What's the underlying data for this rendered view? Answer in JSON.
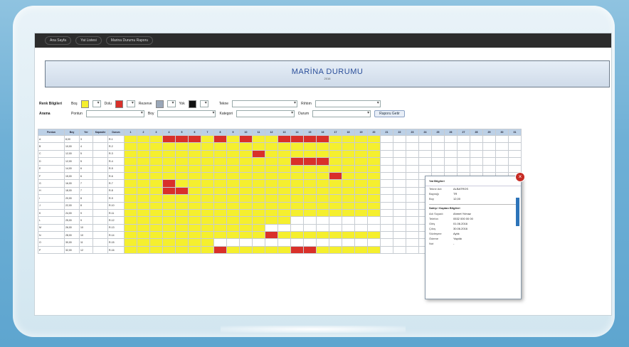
{
  "topbar": {
    "crumbs": [
      "Ana Sayfa",
      "Yat Listesi",
      "Marina Durumu Raporu"
    ]
  },
  "header": {
    "title": "MARİNA DURUMU",
    "subtitle": "2016"
  },
  "filters": {
    "row1_label": "Renk Bilgileri",
    "legend": [
      {
        "label": "Boş",
        "color": "#f5ef2e"
      },
      {
        "label": "Dolu",
        "color": "#d9302a"
      },
      {
        "label": "Rezerve",
        "color": "#9aa7b8"
      },
      {
        "label": "Yok",
        "color": "#111111"
      }
    ],
    "field_a": "Tekne",
    "field_b": "Rıhtım",
    "row2_label": "Arama",
    "field_c": "Pontun",
    "field_d": "Boy",
    "field_e": "Kategori",
    "field_f": "Durum",
    "search_button": "Raporu Getir"
  },
  "grid": {
    "headers": [
      "Pontun",
      "Boy",
      "Yer",
      "Kapasite",
      "Durum",
      "1",
      "2",
      "3",
      "4",
      "5",
      "6",
      "7",
      "8",
      "9",
      "10",
      "11",
      "12",
      "13",
      "14",
      "15",
      "16",
      "17",
      "18",
      "19",
      "20",
      "21",
      "22",
      "23",
      "24",
      "25",
      "26",
      "27",
      "28",
      "29",
      "30",
      "31"
    ],
    "rows": [
      {
        "c": [
          "A",
          "8,00",
          "3",
          "",
          "R-1"
        ],
        "s": "yyyrrryryryyrrrryyyy"
      },
      {
        "c": [
          "B",
          "10,00",
          "4",
          "",
          "R-2"
        ],
        "s": "yyyyyyyyyyyyyyyyyyyy"
      },
      {
        "c": [
          "C",
          "12,00",
          "5",
          "",
          "R-3"
        ],
        "s": "yyyyyyyyyyryyyyyyyyy"
      },
      {
        "c": [
          "D",
          "12,00",
          "5",
          "",
          "R-4"
        ],
        "s": "yyyyyyyyyyyyyrrryyyy"
      },
      {
        "c": [
          "E",
          "14,00",
          "6",
          "",
          "R-5"
        ],
        "s": "yyyyyyyyyyyyyyyyyyyy"
      },
      {
        "c": [
          "F",
          "15,00",
          "6",
          "",
          "R-6"
        ],
        "s": "yyyyyyyyyyyyyyyyryyy"
      },
      {
        "c": [
          "G",
          "16,00",
          "7",
          "",
          "R-7"
        ],
        "s": "yyyryyyyyyyyyyyyyyyy"
      },
      {
        "c": [
          "H",
          "18,00",
          "7",
          "",
          "R-8"
        ],
        "s": "yyyrryyyyyyyyyyyyyyy"
      },
      {
        "c": [
          "I",
          "20,00",
          "8",
          "",
          "R-9"
        ],
        "s": "yyyyyyyyyyyyyyyyyyyy"
      },
      {
        "c": [
          "J",
          "22,00",
          "8",
          "",
          "R-10"
        ],
        "s": "yyyyyyyyyyyyyyyyyyyy"
      },
      {
        "c": [
          "K",
          "24,00",
          "9",
          "",
          "R-11"
        ],
        "s": "yyyyyyyyyyyyyyyyyyyy"
      },
      {
        "c": [
          "L",
          "25,00",
          "9",
          "",
          "R-12"
        ],
        "s": "yyyyyyyyyyyyywwwwwww"
      },
      {
        "c": [
          "M",
          "26,00",
          "10",
          "",
          "R-13"
        ],
        "s": "yyyyyyyyyyywwwwwwwww"
      },
      {
        "c": [
          "N",
          "28,00",
          "10",
          "",
          "R-14"
        ],
        "s": "yyyyyyyyyyyryyyyyyyy"
      },
      {
        "c": [
          "O",
          "30,00",
          "11",
          "",
          "R-15"
        ],
        "s": "yyyyyyywwwwwwwwwwwww"
      },
      {
        "c": [
          "P",
          "32,00",
          "12",
          "",
          "R-16"
        ],
        "s": "yyyyyyyryyyyyrryyyyy"
      }
    ]
  },
  "popup": {
    "title": "Yat Bilgileri",
    "lines": [
      {
        "k": "Tekne Adı",
        "v": "ALBATROS"
      },
      {
        "k": "Bayrağı",
        "v": "TR"
      },
      {
        "k": "Boy",
        "v": "12,00"
      }
    ],
    "section": "Sahip / Kaptan Bilgileri",
    "lines2": [
      {
        "k": "Adı Soyadı",
        "v": "Ahmet Yılmaz"
      },
      {
        "k": "Telefon",
        "v": "0532 000 00 00"
      },
      {
        "k": "Giriş",
        "v": "01.06.2016"
      },
      {
        "k": "Çıkış",
        "v": "30.06.2016"
      },
      {
        "k": "Sözleşme",
        "v": "Aylık"
      },
      {
        "k": "Ödeme",
        "v": "Yapıldı"
      },
      {
        "k": "Not",
        "v": "-"
      }
    ]
  }
}
